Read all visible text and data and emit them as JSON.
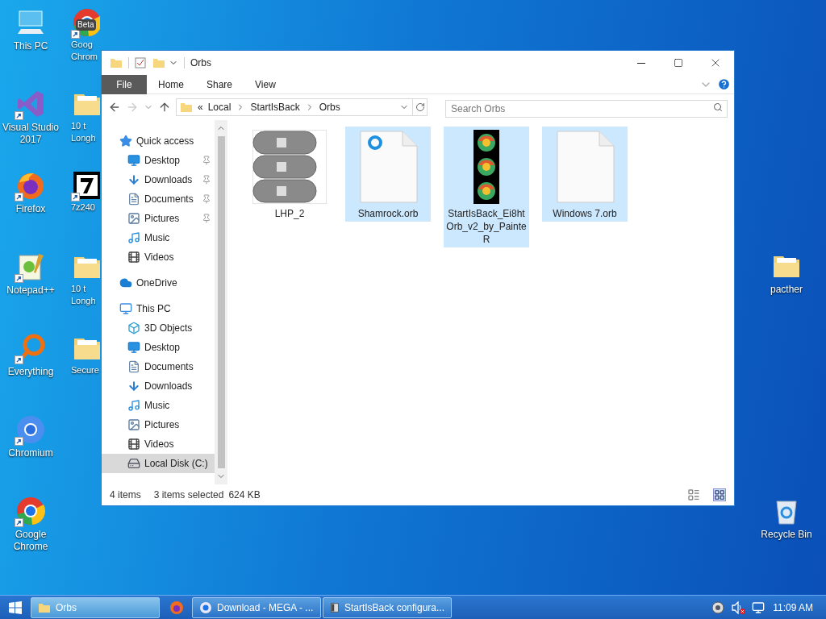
{
  "desktop": {
    "left_column": [
      {
        "label": "This PC",
        "kind": "pc",
        "shortcut": false
      },
      {
        "label": "Visual Studio 2017",
        "kind": "vs",
        "shortcut": true
      },
      {
        "label": "Firefox",
        "kind": "firefox",
        "shortcut": true
      },
      {
        "label": "Notepad++",
        "kind": "notepad",
        "shortcut": true
      },
      {
        "label": "Everything",
        "kind": "search",
        "shortcut": true
      },
      {
        "label": "Chromium",
        "kind": "chromium",
        "shortcut": true
      },
      {
        "label": "Google Chrome",
        "kind": "chrome",
        "shortcut": true
      }
    ],
    "partial_column": [
      {
        "lines": [
          "Goog",
          "Chrom"
        ],
        "kind": "chrome",
        "badge": "Beta",
        "shortcut": true
      },
      {
        "lines": [
          "10 t",
          "Longh"
        ],
        "kind": "folder",
        "shortcut": false
      },
      {
        "lines": [
          "7z240"
        ],
        "kind": "sevenzip",
        "shortcut": true
      },
      {
        "lines": [
          "10 t",
          "Longh"
        ],
        "kind": "folder",
        "shortcut": false
      },
      {
        "lines": [
          "Secure"
        ],
        "kind": "folder",
        "shortcut": false
      }
    ],
    "right_column": [
      {
        "label": "pacther",
        "kind": "folder",
        "shortcut": false
      },
      {
        "label": "Recycle Bin",
        "kind": "recycle",
        "shortcut": false
      }
    ]
  },
  "window": {
    "title": "Orbs",
    "ribbon_tabs": [
      {
        "label": "File",
        "selected": true
      },
      {
        "label": "Home",
        "selected": false
      },
      {
        "label": "Share",
        "selected": false
      },
      {
        "label": "View",
        "selected": false
      }
    ],
    "breadcrumb": [
      "«",
      "Local",
      "StartIsBack",
      "Orbs"
    ],
    "search": {
      "placeholder": "Search Orbs"
    },
    "nav": [
      {
        "label": "Quick access",
        "kind": "star",
        "selected": false,
        "children": [
          {
            "label": "Desktop",
            "kind": "desktop",
            "pinned": true,
            "selected": false
          },
          {
            "label": "Downloads",
            "kind": "download",
            "pinned": true,
            "selected": false
          },
          {
            "label": "Documents",
            "kind": "document",
            "pinned": true,
            "selected": false
          },
          {
            "label": "Pictures",
            "kind": "picture",
            "pinned": true,
            "selected": false
          },
          {
            "label": "Music",
            "kind": "music",
            "pinned": false,
            "selected": false
          },
          {
            "label": "Videos",
            "kind": "video",
            "pinned": false,
            "selected": false
          }
        ]
      },
      {
        "label": "OneDrive",
        "kind": "cloud",
        "selected": false
      },
      {
        "label": "This PC",
        "kind": "pc",
        "selected": false,
        "children": [
          {
            "label": "3D Objects",
            "kind": "cube",
            "pinned": false,
            "selected": false
          },
          {
            "label": "Desktop",
            "kind": "desktop",
            "pinned": false,
            "selected": false
          },
          {
            "label": "Documents",
            "kind": "document",
            "pinned": false,
            "selected": false
          },
          {
            "label": "Downloads",
            "kind": "download",
            "pinned": false,
            "selected": false
          },
          {
            "label": "Music",
            "kind": "music",
            "pinned": false,
            "selected": false
          },
          {
            "label": "Pictures",
            "kind": "picture",
            "pinned": false,
            "selected": false
          },
          {
            "label": "Videos",
            "kind": "video",
            "pinned": false,
            "selected": false
          },
          {
            "label": "Local Disk (C:)",
            "kind": "drive",
            "pinned": false,
            "selected": true
          }
        ]
      }
    ],
    "files": [
      {
        "name": "LHP_2",
        "kind": "strip-gray",
        "selected": false
      },
      {
        "name": "Shamrock.orb",
        "kind": "file-ring",
        "selected": true
      },
      {
        "name": "StartIsBack_Ei8htOrb_v2_by_PainteR",
        "kind": "strip-orbs",
        "selected": true
      },
      {
        "name": "Windows 7.orb",
        "kind": "file",
        "selected": true
      }
    ],
    "status_bar": {
      "count": "4 items",
      "selection": "3 items selected",
      "size": "624 KB"
    }
  },
  "taskbar": {
    "items": [
      {
        "label": "Orbs",
        "kind": "folder",
        "selected": true
      },
      {
        "kind": "firefox",
        "selected": false
      },
      {
        "label": "Download - MEGA - ...",
        "kind": "chrome",
        "selected": false
      },
      {
        "label": "StartIsBack configura...",
        "kind": "app",
        "selected": false
      }
    ],
    "clock": "11:09 AM"
  }
}
